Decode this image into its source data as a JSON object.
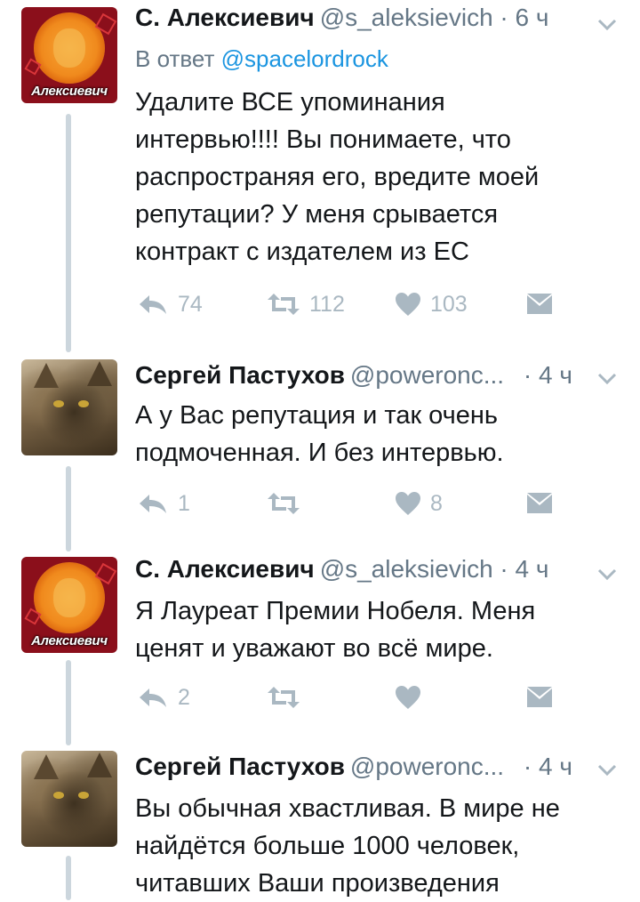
{
  "colors": {
    "muted": "#657786",
    "link": "#1b95e0",
    "icon": "#aab8c2",
    "thread": "#ccd6dd",
    "text": "#14171a"
  },
  "icons": {
    "reply": "reply-icon",
    "retweet": "retweet-icon",
    "like": "heart-icon",
    "dm": "envelope-icon",
    "caret": "chevron-down-icon"
  },
  "tweets": [
    {
      "avatar_label": "Алексиевич",
      "name": "С. Алексиевич",
      "handle": "@s_aleksievich",
      "time": "· 6 ч",
      "reply_prefix": "В ответ",
      "reply_to": "@spacelordrock",
      "lines": [
        "Удалите ВСЕ упоминания",
        "интервью!!!! Вы понимаете, что",
        "распространяя его, вредите моей",
        "репутации? У меня срывается",
        "контракт с издателем из ЕС"
      ],
      "replies": "74",
      "retweets": "112",
      "likes": "103"
    },
    {
      "name": "Сергей Пастухов",
      "handle": "@poweronc...",
      "time": "· 4 ч",
      "lines": [
        "А у Вас репутация и так очень",
        "подмоченная. И без интервью."
      ],
      "replies": "1",
      "retweets": "",
      "likes": "8"
    },
    {
      "avatar_label": "Алексиевич",
      "name": "С. Алексиевич",
      "handle": "@s_aleksievich",
      "time": "· 4 ч",
      "lines": [
        "Я Лауреат Премии Нобеля. Меня",
        "ценят и уважают во всё мире."
      ],
      "replies": "2",
      "retweets": "",
      "likes": ""
    },
    {
      "name": "Сергей Пастухов",
      "handle": "@poweronc...",
      "time": "· 4 ч",
      "lines": [
        "Вы обычная хвастливая. В мире не",
        "найдётся больше 1000 человек,",
        "читавших Ваши произведения"
      ]
    }
  ]
}
